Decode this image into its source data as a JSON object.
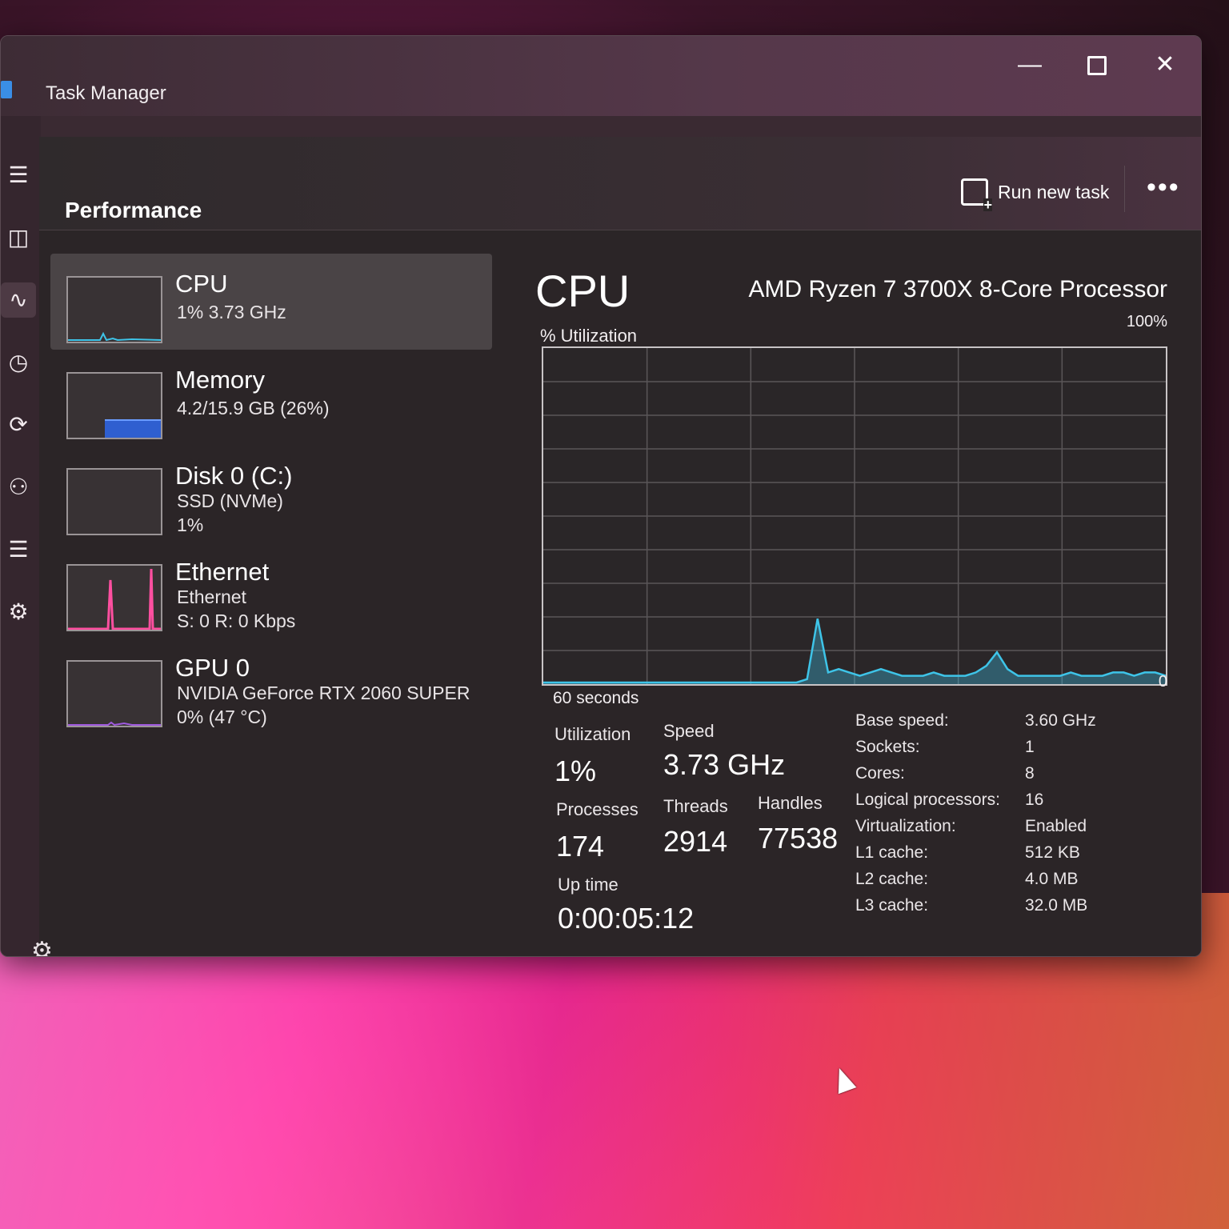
{
  "window": {
    "title": "Task Manager"
  },
  "header": {
    "page_title": "Performance",
    "run_new_task": "Run new task",
    "more": "•••"
  },
  "nav": {
    "icons": [
      "hamburger-icon",
      "processes-icon",
      "performance-icon",
      "app-history-icon",
      "startup-icon",
      "users-icon",
      "details-icon",
      "services-icon"
    ],
    "settings": "gear-icon"
  },
  "resources": [
    {
      "name": "CPU",
      "line1": "1% 3.73 GHz",
      "line2": "",
      "color": "#3ec4e8"
    },
    {
      "name": "Memory",
      "line1": "4.2/15.9 GB (26%)",
      "line2": "",
      "color": "#3a6ee6"
    },
    {
      "name": "Disk 0 (C:)",
      "line1": "SSD (NVMe)",
      "line2": "1%",
      "color": "#7fd04a"
    },
    {
      "name": "Ethernet",
      "line1": "Ethernet",
      "line2": "S: 0 R: 0 Kbps",
      "color": "#ff4fa0"
    },
    {
      "name": "GPU 0",
      "line1": "NVIDIA GeForce RTX 2060 SUPER",
      "line2": "0% (47 °C)",
      "color": "#a05ae0"
    }
  ],
  "cpu_panel": {
    "title": "CPU",
    "model": "AMD Ryzen 7 3700X 8-Core Processor",
    "util_label": "% Utilization",
    "max_label": "100%",
    "min_label": "0",
    "x_label": "60 seconds",
    "stats": {
      "utilization_label": "Utilization",
      "utilization": "1%",
      "speed_label": "Speed",
      "speed": "3.73 GHz",
      "processes_label": "Processes",
      "processes": "174",
      "threads_label": "Threads",
      "threads": "2914",
      "handles_label": "Handles",
      "handles": "77538",
      "uptime_label": "Up time",
      "uptime": "0:00:05:12"
    },
    "details": [
      {
        "label": "Base speed:",
        "value": "3.60 GHz"
      },
      {
        "label": "Sockets:",
        "value": "1"
      },
      {
        "label": "Cores:",
        "value": "8"
      },
      {
        "label": "Logical processors:",
        "value": "16"
      },
      {
        "label": "Virtualization:",
        "value": "Enabled"
      },
      {
        "label": "L1 cache:",
        "value": "512 KB"
      },
      {
        "label": "L2 cache:",
        "value": "4.0 MB"
      },
      {
        "label": "L3 cache:",
        "value": "32.0 MB"
      }
    ],
    "graph_values": [
      0,
      0,
      0,
      0,
      0,
      0,
      0,
      0,
      0,
      0,
      0,
      0,
      0,
      0,
      0,
      0,
      0,
      0,
      0,
      0,
      0,
      0,
      0,
      0,
      0,
      1,
      19,
      3,
      4,
      3,
      2,
      3,
      4,
      3,
      2,
      2,
      2,
      3,
      2,
      2,
      2,
      3,
      5,
      9,
      4,
      2,
      2,
      2,
      2,
      2,
      3,
      2,
      2,
      2,
      3,
      3,
      2,
      3,
      3,
      2
    ]
  }
}
